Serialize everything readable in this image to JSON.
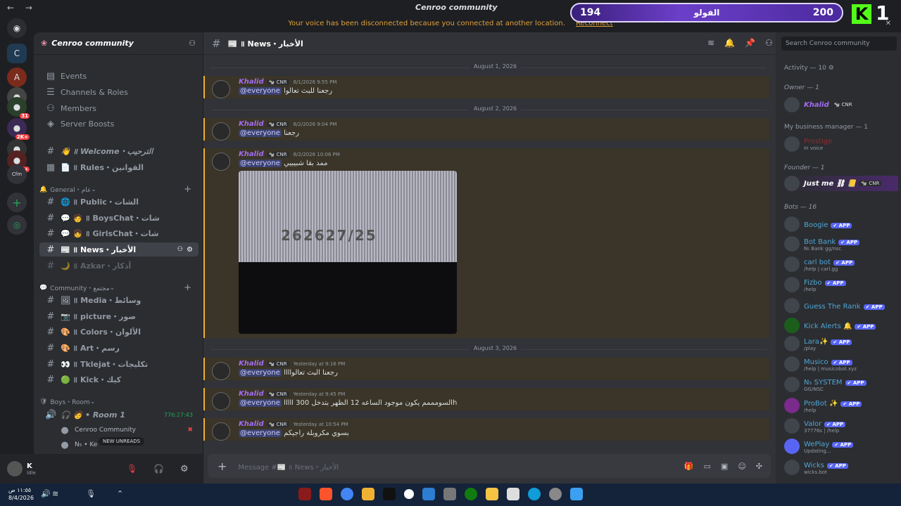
{
  "window": {
    "title": "Cenroo community",
    "notice": "Your voice has been disconnected because you connected at another location.",
    "notice_link": "Reconnect"
  },
  "overlay": {
    "left": "194",
    "center": "الفولو",
    "right": "200",
    "kick_count": "1"
  },
  "rail": {
    "items": [
      {
        "name": "discord-home-icon",
        "glyph": "◉"
      },
      {
        "name": "server-cenroo",
        "glyph": "C"
      },
      {
        "name": "server-attack",
        "glyph": "A"
      },
      {
        "name": "server-3",
        "glyph": "●"
      },
      {
        "name": "server-4",
        "glyph": "●",
        "badge": "31"
      },
      {
        "name": "server-5",
        "glyph": "●",
        "badge": "2K+"
      },
      {
        "name": "server-6",
        "glyph": "●"
      },
      {
        "name": "server-7",
        "glyph": "●",
        "badge": "1K+"
      },
      {
        "name": "server-cfm",
        "glyph": "Cfm"
      },
      {
        "name": "add-server-icon",
        "glyph": "+"
      },
      {
        "name": "explore-icon",
        "glyph": "◎"
      }
    ]
  },
  "sidebar": {
    "server_name": "Cenroo community",
    "top_items": [
      "Events",
      "Channels & Roles",
      "Members",
      "Server Boosts"
    ],
    "channels": [
      {
        "label": "👋 ॥ Welcome・الترحيب",
        "icon": "#"
      },
      {
        "label": "📄 ॥ Rules・القوانين",
        "icon": "▦"
      }
    ],
    "cat_general": "General・عام",
    "general_channels": [
      {
        "label": "🌐 ॥ Public・الشات",
        "icon": "#"
      },
      {
        "label": "💬 🧑 ॥ BoysChat・شات",
        "icon": "#"
      },
      {
        "label": "💬 👧 ॥ GirlsChat・شات",
        "icon": "#"
      },
      {
        "label": "📰 ॥ News・الأخبار",
        "icon": "#",
        "active": true
      },
      {
        "label": "🌙 ॥ Azkar・أذكار",
        "icon": "#"
      }
    ],
    "cat_community": "Community・مجتمع",
    "community_channels": [
      {
        "label": "🖼 ॥ Media・وسائط",
        "icon": "#"
      },
      {
        "label": "📷 ॥ picture・صور",
        "icon": "#"
      },
      {
        "label": "🎨 ॥ Colors・الألوان",
        "icon": "#"
      },
      {
        "label": "🎨 ॥ Art・رسم",
        "icon": "#"
      },
      {
        "label": "👀 ॥ Tklejat・تكليجات",
        "icon": "#"
      },
      {
        "label": "🟢 ॥ Kick・كيك",
        "icon": "#"
      }
    ],
    "cat_boys": "Boys・Room",
    "voice_room": "🎧 🧑 • Room 1",
    "voice_timer": "776:27:43",
    "voice_user": "Cenroo Community",
    "voice_user2": "N₅ • Ke",
    "new_unreads": "NEW UNREADS",
    "user_name": "K",
    "user_status": "Idle"
  },
  "chat": {
    "channel": "📰 ॥ News・الأخبار",
    "divider1": "August 1, 2026",
    "divider2": "August 2, 2026",
    "divider3": "August 3, 2026",
    "messages": [
      {
        "author": "Khalid",
        "tag": "🐄 CNR",
        "time": "8/1/2026 9:55 PM",
        "text": "رجعنا للبث تعالوا"
      },
      {
        "author": "Khalid",
        "tag": "🐄 CNR",
        "time": "8/2/2026 9:04 PM",
        "text": "رجعنا"
      },
      {
        "author": "Khalid",
        "tag": "🐄 CNR",
        "time": "8/2/2026 10:06 PM",
        "text": "ممد بقا شبيبيي"
      },
      {
        "author": "Khalid",
        "tag": "🐄 CNR",
        "time": "Yesterday at 9:16 PM",
        "text": "رجعنا البث تعالواااا"
      },
      {
        "author": "Khalid",
        "tag": "🐄 CNR",
        "time": "Yesterday at 9:45 PM",
        "text": "السومممم يكون موجود الساعه 12 الظهر بتدخل 300 اااااh"
      },
      {
        "author": "Khalid",
        "tag": "🐄 CNR",
        "time": "Yesterday at 10:54 PM",
        "text": "بسوي مكروبلة راجيكم"
      }
    ],
    "mention": "@everyone",
    "image_text": "262627/25",
    "composer_placeholder": "Message #📰 ॥ News・الأخبار"
  },
  "members": {
    "search_placeholder": "Search Cenroo community",
    "activity": "Activity — 10",
    "owner_header": "Owner — 1",
    "owner": {
      "name": "Khalid",
      "tag": "🐄 CNR"
    },
    "manager_header": "My business manager — 1",
    "manager": {
      "name": "Prestige",
      "sub": "In voice"
    },
    "founder_header": "Founder — 1",
    "founder": {
      "name": "Just me ⛓ 📒",
      "tag": "🐄 CNR"
    },
    "bots_header": "Bots — 16",
    "bots": [
      {
        "name": "Boogie",
        "sub": ""
      },
      {
        "name": "Bot Bank",
        "sub": "N₅ Bank gg/nsc"
      },
      {
        "name": "carl bot",
        "sub": "/help | carl.gg"
      },
      {
        "name": "Fizbo",
        "sub": "/help"
      },
      {
        "name": "Guess The Rank",
        "sub": ""
      },
      {
        "name": "Kick Alerts 🔔",
        "sub": ""
      },
      {
        "name": "Lara✨",
        "sub": "/play"
      },
      {
        "name": "Musico",
        "sub": "/help | musicobot.xyz"
      },
      {
        "name": "N₅ SYSTEM",
        "sub": "GG/NSC"
      },
      {
        "name": "ProBot ✨",
        "sub": "/help"
      },
      {
        "name": "Valor",
        "sub": "37776s | /help"
      },
      {
        "name": "WePlay",
        "sub": "Updating..."
      },
      {
        "name": "Wicks",
        "sub": "wicks.bot"
      }
    ],
    "app_label": "✔ APP"
  },
  "taskbar": {
    "time": "١١:٥٥ ص",
    "date": "8/4/2026"
  },
  "colors": {
    "accent": "#5865f2",
    "author": "#a26cf0",
    "highlight_border": "#f0b232",
    "kick_green": "#53fc18"
  }
}
